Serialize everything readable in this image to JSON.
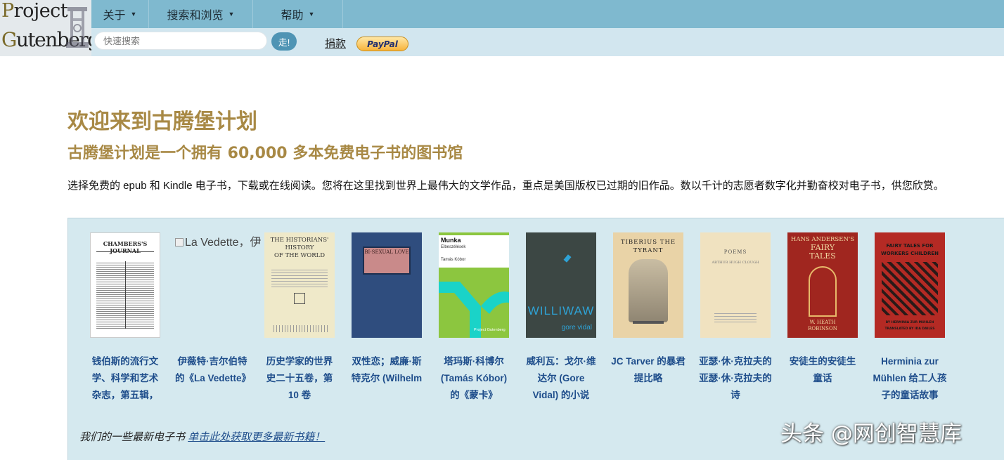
{
  "logo": {
    "line1_cap": "P",
    "line1_rest": "roject",
    "line2_cap": "G",
    "line2_rest": "utenberg"
  },
  "nav": {
    "items": [
      {
        "label": "关于",
        "icon": "chevron-down-icon"
      },
      {
        "label": "搜索和浏览",
        "icon": "chevron-down-icon"
      },
      {
        "label": "帮助",
        "icon": "chevron-down-icon"
      }
    ]
  },
  "search": {
    "placeholder": "快速搜索",
    "value": "",
    "go_label": "走!"
  },
  "donate": {
    "label": "捐款",
    "paypal_label": "PayPal"
  },
  "main": {
    "title": "欢迎来到古腾堡计划",
    "subtitle": "古腾堡计划是一个拥有 60,000 多本免费电子书的图书馆",
    "intro": "选择免费的 epub 和 Kindle 电子书，下载或在线阅读。您将在这里找到世界上最伟大的文学作品，重点是美国版权已过期的旧作品。数以千计的志愿者数字化并勤奋校对电子书，供您欣赏。"
  },
  "books": [
    {
      "title": "钱伯斯的流行文学、科学和艺术杂志，第五辑，",
      "cover_lines": [
        "CHAMBERS'S JOURNAL"
      ]
    },
    {
      "title": "伊薇特·吉尔伯特的《La Vedette》",
      "cover_alt": "La Vedette，伊",
      "cover_alt_tail": "…"
    },
    {
      "title": "历史学家的世界史二十五卷，第 10 卷",
      "cover_lines": [
        "THE HISTORIANS'",
        "HISTORY",
        "OF THE WORLD"
      ]
    },
    {
      "title": "双性恋；威廉·斯特克尔 (Wilhelm",
      "cover_lines": [
        "BI-SEXUAL LOVE"
      ]
    },
    {
      "title": "塔玛斯·科博尔 (Tamás Kóbor) 的《蒙卡》",
      "cover_lines": [
        "Munka",
        "Elbeszélések",
        "Tamás Kóbor",
        "Project Gutenberg"
      ]
    },
    {
      "title": "威利瓦：戈尔·维达尔 (Gore Vidal) 的小说",
      "cover_lines": [
        "WILLIWAW",
        "gore vidal"
      ]
    },
    {
      "title": "JC Tarver 的暴君提比略",
      "cover_lines": [
        "TIBERIUS THE",
        "TYRANT"
      ]
    },
    {
      "title": "亚瑟·休·克拉夫的亚瑟·休·克拉夫的诗",
      "cover_lines": [
        "POEMS",
        "ARTHUR HUGH CLOUGH"
      ]
    },
    {
      "title": "安徒生的安徒生童话",
      "cover_lines": [
        "HANS ANDERSEN'S",
        "FAIRY",
        "TALES",
        "W. HEATH",
        "ROBINSON"
      ]
    },
    {
      "title": "Herminia zur Mühlen 给工人孩子的童话故事",
      "cover_lines": [
        "FAIRY TALES FOR",
        "WORKERS CHILDREN",
        "BY HERMINIA ZUR MUHLEN",
        "TRANSLATED BY IDA DAILES"
      ]
    }
  ],
  "footer": {
    "note": "我们的一些最新电子书",
    "link": "单击此处获取更多最新书籍！"
  },
  "watermark": "头条 @网创智慧库",
  "colors": {
    "nav_bg": "#7fb9cf",
    "subbar_bg": "#d2e6ef",
    "heading": "#a88945",
    "link": "#1e4d8b",
    "panel_bg": "#d5e9ef"
  }
}
